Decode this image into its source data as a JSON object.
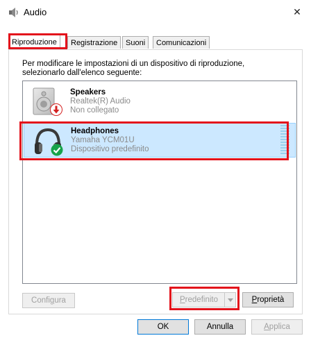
{
  "window": {
    "title": "Audio",
    "close_glyph": "✕"
  },
  "tabs": [
    {
      "label": "Riproduzione",
      "active": true
    },
    {
      "label": "Registrazione",
      "active": false
    },
    {
      "label": "Suoni",
      "active": false
    },
    {
      "label": "Comunicazioni",
      "active": false
    }
  ],
  "instructions": {
    "line1": "Per modificare le impostazioni di un dispositivo di riproduzione,",
    "line2": "selezionarlo dall'elenco seguente:"
  },
  "devices": [
    {
      "name": "Speakers",
      "driver": "Realtek(R) Audio",
      "status": "Non collegato",
      "icon": "speaker-icon",
      "badge": "disconnected-arrow-icon",
      "selected": false
    },
    {
      "name": "Headphones",
      "driver": "Yamaha YCM01U",
      "status": "Dispositivo predefinito",
      "icon": "headphones-icon",
      "badge": "default-check-icon",
      "selected": true
    }
  ],
  "buttons": {
    "configure": {
      "pre": "Confi",
      "accel": "g",
      "post": "ura",
      "enabled": false
    },
    "set_default": {
      "pre": "",
      "accel": "P",
      "post": "redefinito",
      "enabled": false
    },
    "properties": {
      "pre": "",
      "accel": "P",
      "post": "roprietà",
      "enabled": true
    },
    "ok": "OK",
    "cancel": "Annulla",
    "apply": {
      "pre": "",
      "accel": "A",
      "post": "pplica",
      "enabled": false
    }
  },
  "colors": {
    "highlight_outline": "#e3121b",
    "selection_bg": "#cce8ff",
    "badge_green": "#16a34a",
    "badge_red": "#d42020"
  }
}
